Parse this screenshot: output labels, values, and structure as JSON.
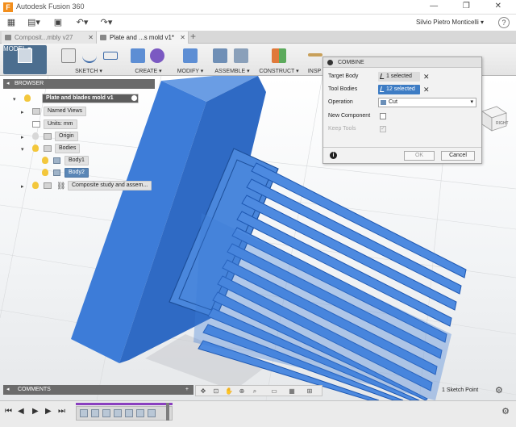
{
  "titlebar": {
    "title": "Autodesk Fusion 360",
    "window_buttons": "— ❐ ✕"
  },
  "quickbar": {
    "user": "Silvio Pietro Monticelli ▾",
    "help": "?"
  },
  "tabs": [
    {
      "label": "Composit...mbly v27",
      "active": false
    },
    {
      "label": "Plate and ...s mold v1*",
      "active": true
    }
  ],
  "ribbon": {
    "model": "MODEL ▾",
    "sketch": "SKETCH ▾",
    "create": "CREATE ▾",
    "modify": "MODIFY ▾",
    "assemble": "ASSEMBLE ▾",
    "construct": "CONSTRUCT ▾",
    "inspect": "INSP"
  },
  "browser": {
    "header": "BROWSER",
    "root": "Plate and blades mold v1",
    "items": [
      {
        "label": "Named Views"
      },
      {
        "label": "Units: mm"
      },
      {
        "label": "Origin"
      },
      {
        "label": "Bodies"
      },
      {
        "label": "Body1"
      },
      {
        "label": "Body2"
      },
      {
        "label": "Composite study and assem..."
      }
    ]
  },
  "dialog": {
    "title": "COMBINE",
    "target_body_label": "Target Body",
    "target_body_value": "1 selected",
    "tool_bodies_label": "Tool Bodies",
    "tool_bodies_value": "12 selected",
    "operation_label": "Operation",
    "operation_value": "Cut",
    "new_component_label": "New Component",
    "keep_tools_label": "Keep Tools",
    "ok": "OK",
    "cancel": "Cancel",
    "info": "i"
  },
  "viewcube": {
    "face": "RIGHT"
  },
  "comments": {
    "label": "COMMENTS",
    "plus": "+"
  },
  "status": {
    "text": "1 Sketch Point"
  },
  "colors": {
    "body": "#3d7cd8",
    "body_dark": "#2a5fb0",
    "selected": "#5a86b6",
    "dialog_blue": "#3d7cc4"
  }
}
